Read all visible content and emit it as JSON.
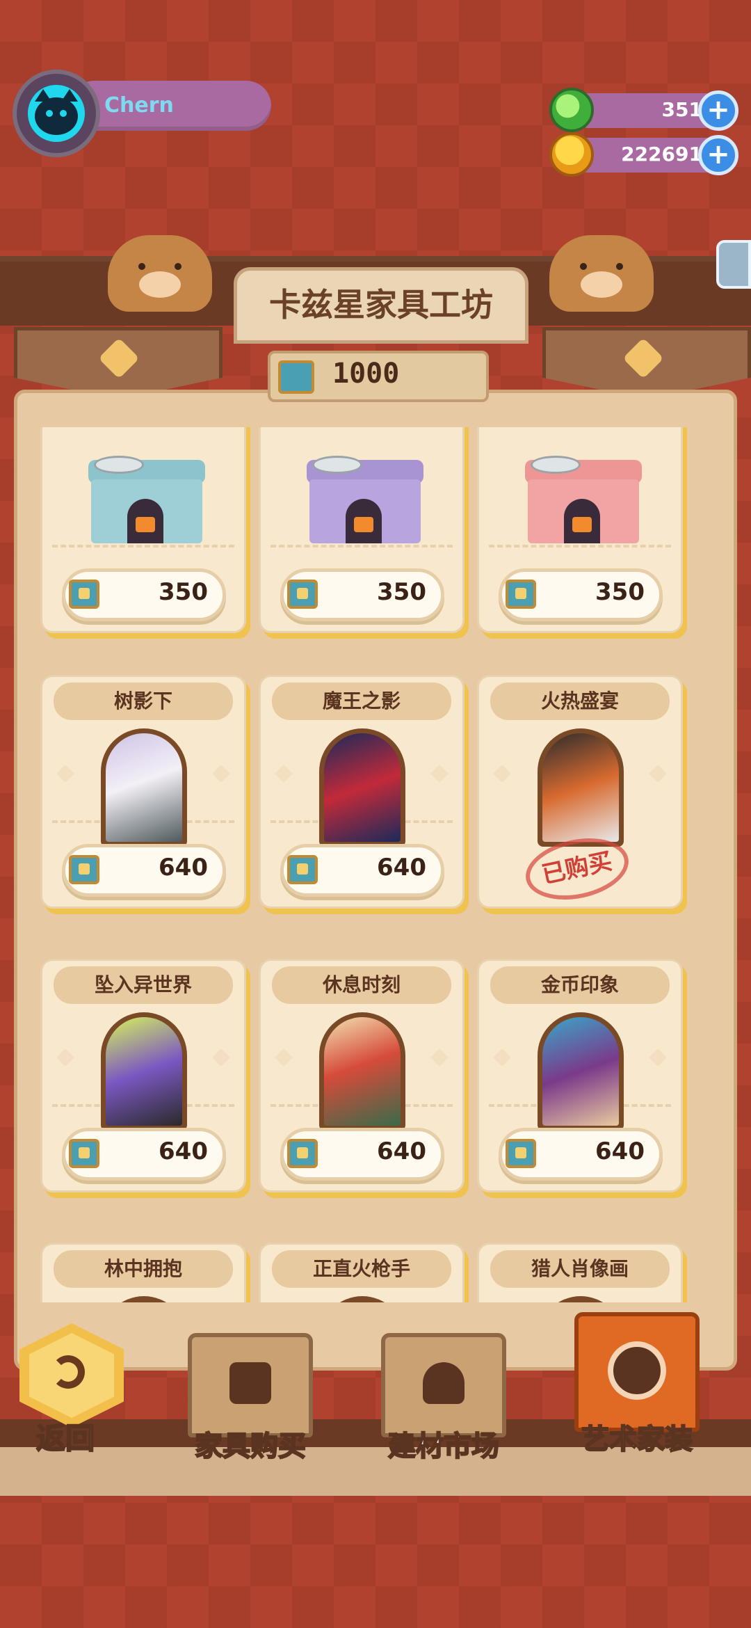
{
  "player": {
    "name": "Chern"
  },
  "currencies": [
    {
      "name": "gem",
      "icon": "green-gem-icon",
      "value": "351"
    },
    {
      "name": "coin",
      "icon": "gold-coin-icon",
      "value": "222691"
    }
  ],
  "shop": {
    "title": "卡兹星家具工坊",
    "balance": "1000"
  },
  "top_row": [
    {
      "icon": "blue-fish-house-icon",
      "price": "350",
      "colors": [
        "#9ecfd6",
        "#3f8b57"
      ]
    },
    {
      "icon": "purple-fish-house-icon",
      "price": "350",
      "colors": [
        "#b8a5df",
        "#f1ecf7"
      ]
    },
    {
      "icon": "pink-fish-house-icon",
      "price": "350",
      "colors": [
        "#f2a4a4",
        "#f9d7d2"
      ]
    }
  ],
  "items": [
    {
      "name": "树影下",
      "price": "640",
      "purchased": false,
      "art": [
        "#cfc3e6",
        "#4f5a5c"
      ]
    },
    {
      "name": "魔王之影",
      "price": "640",
      "purchased": false,
      "art": [
        "#c22a3a",
        "#1c2a5a"
      ]
    },
    {
      "name": "火热盛宴",
      "price": "",
      "purchased": true,
      "purchased_label": "已购买",
      "art": [
        "#2c2c2c",
        "#d86a30"
      ]
    },
    {
      "name": "坠入异世界",
      "price": "640",
      "purchased": false,
      "art": [
        "#d7f25a",
        "#7a58c2"
      ]
    },
    {
      "name": "休息时刻",
      "price": "640",
      "purchased": false,
      "art": [
        "#d64b3a",
        "#f3e0b0"
      ]
    },
    {
      "name": "金币印象",
      "price": "640",
      "purchased": false,
      "art": [
        "#7a3a8a",
        "#3aa6c9"
      ]
    },
    {
      "name": "林中拥抱",
      "price": "",
      "purchased": false,
      "art": [
        "#7a4a27",
        "#7a4a27"
      ]
    },
    {
      "name": "正直火枪手",
      "price": "",
      "purchased": false,
      "art": [
        "#7a4a27",
        "#7a4a27"
      ]
    },
    {
      "name": "猎人肖像画",
      "price": "",
      "purchased": false,
      "art": [
        "#7a4a27",
        "#7a4a27"
      ]
    }
  ],
  "nav": {
    "back": "返回",
    "tabs": [
      {
        "label": "家具购买",
        "icon": "gift-icon",
        "active": false
      },
      {
        "label": "建材市场",
        "icon": "paint-brush-icon",
        "active": false
      },
      {
        "label": "艺术家装",
        "icon": "art-badge-icon",
        "active": true
      }
    ]
  },
  "colors": {
    "card_shadow": "#f0c24e",
    "active_tab": "#e06a23",
    "background": "#b1422f"
  }
}
